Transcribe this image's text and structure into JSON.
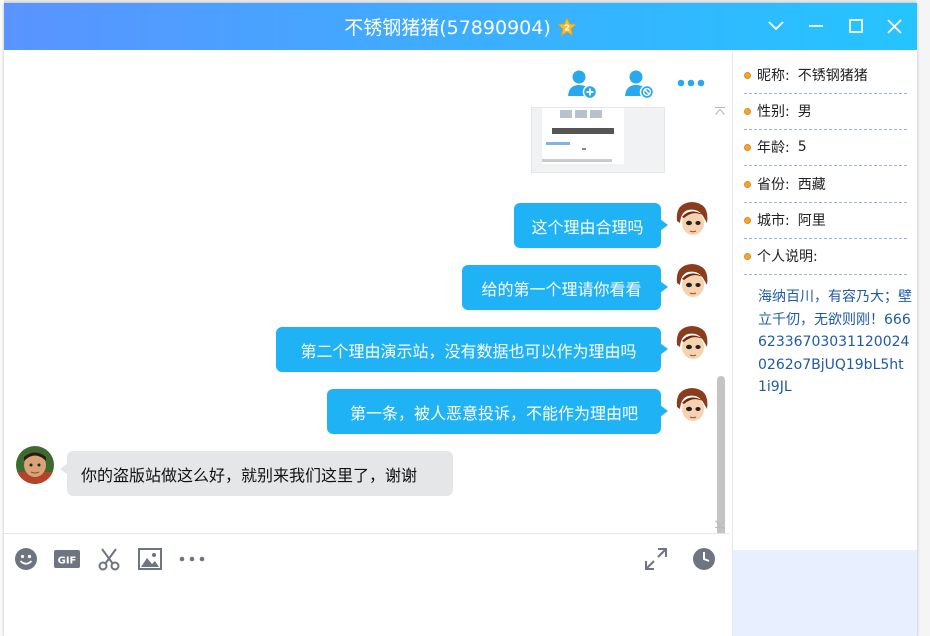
{
  "window": {
    "title": "不锈钢猪猪(57890904)",
    "vip_level": "2",
    "buttons": [
      "chevron-down-icon",
      "minimize-icon",
      "maximize-icon",
      "close-icon"
    ]
  },
  "colors": {
    "titlebar_start": "#5a93ff",
    "titlebar_end": "#25c4ff",
    "bubble_out": "#1fb3f5",
    "bubble_in": "#e5e6e8",
    "bio_text": "#1e5aa8",
    "bullet": "#f2a33a"
  },
  "profile": {
    "rows": [
      {
        "key": "昵称:",
        "value": "不锈钢猪猪"
      },
      {
        "key": "性别:",
        "value": "男"
      },
      {
        "key": "年龄:",
        "value": "5"
      },
      {
        "key": "省份:",
        "value": "西藏"
      },
      {
        "key": "城市:",
        "value": "阿里"
      },
      {
        "key": "个人说明:",
        "value": ""
      }
    ],
    "bio": "海纳百川，有容乃大；壁立千仞，无欲则刚！666623367030311200240262o7BjUQ19bL5ht1i9JL"
  },
  "chat": {
    "top_icons": [
      "add-friend-icon",
      "block-user-icon",
      "more-options-icon"
    ],
    "messages": [
      {
        "side": "out",
        "text": "这个理由合理吗"
      },
      {
        "side": "out",
        "text": "给的第一个理请你看看"
      },
      {
        "side": "out",
        "text": "第二个理由演示站，没有数据也可以作为理由吗"
      },
      {
        "side": "out",
        "text": "第一条，被人恶意投诉，不能作为理由吧"
      },
      {
        "side": "in",
        "text": "你的盗版站做这么好，就别来我们这里了，谢谢"
      }
    ]
  },
  "toolbar": {
    "left": [
      "emoji-icon",
      "gif-icon",
      "scissors-icon",
      "image-icon",
      "more-icon"
    ],
    "right": [
      "expand-icon",
      "history-clock-icon"
    ],
    "gif_label": "GIF"
  }
}
